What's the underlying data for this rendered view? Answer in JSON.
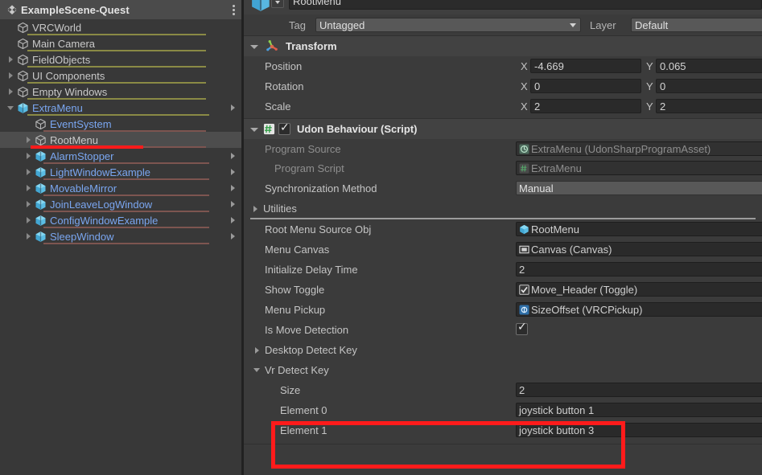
{
  "hierarchy": {
    "scene": {
      "name": "ExampleScene-Quest",
      "icon": "unity-scene-icon",
      "menu_icon": "kebab-menu-icon"
    },
    "items": [
      {
        "label": "VRCWorld",
        "icon": "gameobject-icon",
        "indent": 1,
        "twisty": "none",
        "prefab": false,
        "underline": "#8a8a45",
        "overflow_arrow": false,
        "selected": false
      },
      {
        "label": "Main Camera",
        "icon": "gameobject-icon",
        "indent": 1,
        "twisty": "none",
        "prefab": false,
        "underline": "#8a8a45",
        "overflow_arrow": false,
        "selected": false
      },
      {
        "label": "FieldObjects",
        "icon": "gameobject-icon",
        "indent": 1,
        "twisty": "right",
        "prefab": false,
        "underline": "#8a8a45",
        "overflow_arrow": false,
        "selected": false
      },
      {
        "label": "UI Components",
        "icon": "gameobject-icon",
        "indent": 1,
        "twisty": "right",
        "prefab": false,
        "underline": "#8a8a45",
        "overflow_arrow": false,
        "selected": false
      },
      {
        "label": "Empty Windows",
        "icon": "gameobject-icon",
        "indent": 1,
        "twisty": "right",
        "prefab": false,
        "underline": "#8a8a45",
        "overflow_arrow": false,
        "selected": false
      },
      {
        "label": "ExtraMenu",
        "icon": "prefab-icon",
        "indent": 1,
        "twisty": "down",
        "prefab": true,
        "underline": "#8a8a45",
        "overflow_arrow": true,
        "selected": false
      },
      {
        "label": "EventSystem",
        "icon": "gameobject-icon",
        "indent": 2,
        "twisty": "none",
        "prefab": true,
        "underline": "#7d5550",
        "overflow_arrow": false,
        "selected": false
      },
      {
        "label": "RootMenu",
        "icon": "gameobject-icon",
        "indent": 2,
        "twisty": "right",
        "prefab": false,
        "underline": "#7d5550",
        "overflow_arrow": false,
        "selected": true
      },
      {
        "label": "AlarmStopper",
        "icon": "prefab-icon",
        "indent": 2,
        "twisty": "right",
        "prefab": true,
        "underline": "#7d5550",
        "overflow_arrow": true,
        "selected": false
      },
      {
        "label": "LightWindowExample",
        "icon": "prefab-icon",
        "indent": 2,
        "twisty": "right",
        "prefab": true,
        "underline": "#7d5550",
        "overflow_arrow": true,
        "selected": false
      },
      {
        "label": "MovableMirror",
        "icon": "prefab-icon",
        "indent": 2,
        "twisty": "right",
        "prefab": true,
        "underline": "#7d5550",
        "overflow_arrow": true,
        "selected": false
      },
      {
        "label": "JoinLeaveLogWindow",
        "icon": "prefab-icon",
        "indent": 2,
        "twisty": "right",
        "prefab": true,
        "underline": "#7d5550",
        "overflow_arrow": true,
        "selected": false
      },
      {
        "label": "ConfigWindowExample",
        "icon": "prefab-icon",
        "indent": 2,
        "twisty": "right",
        "prefab": true,
        "underline": "#7d5550",
        "overflow_arrow": true,
        "selected": false
      },
      {
        "label": "SleepWindow",
        "icon": "prefab-icon",
        "indent": 2,
        "twisty": "right",
        "prefab": true,
        "underline": "#7d5550",
        "overflow_arrow": true,
        "selected": false
      }
    ]
  },
  "inspector": {
    "gameobject_name": "RootMenu",
    "enabled_checkbox": true,
    "tag_label": "Tag",
    "tag_value": "Untagged",
    "layer_label": "Layer",
    "layer_value": "Default",
    "transform": {
      "title": "Transform",
      "icon": "transform-axis-icon",
      "rows": [
        {
          "label": "Position",
          "x_axis": "X",
          "x": "-4.669",
          "y_axis": "Y",
          "y": "0.065"
        },
        {
          "label": "Rotation",
          "x_axis": "X",
          "x": "0",
          "y_axis": "Y",
          "y": "0"
        },
        {
          "label": "Scale",
          "x_axis": "X",
          "x": "2",
          "y_axis": "Y",
          "y": "2"
        }
      ]
    },
    "udon": {
      "title": "Udon Behaviour (Script)",
      "icon": "udon-script-icon",
      "enabled": true,
      "program_source_label": "Program Source",
      "program_source_value": "ExtraMenu (UdonSharpProgramAsset)",
      "program_source_icon": "udonsharp-asset-icon",
      "program_script_label": "Program Script",
      "program_script_value": "ExtraMenu",
      "program_script_icon": "script-icon",
      "sync_label": "Synchronization Method",
      "sync_value": "Manual",
      "utilities_label": "Utilities"
    },
    "fields": [
      {
        "label": "Root Menu Source Obj",
        "value": "RootMenu",
        "kind": "object",
        "icon": "prefab-icon"
      },
      {
        "label": "Menu Canvas",
        "value": "Canvas (Canvas)",
        "kind": "object",
        "icon": "canvas-icon"
      },
      {
        "label": "Initialize Delay Time",
        "value": "2",
        "kind": "number",
        "icon": ""
      },
      {
        "label": "Show Toggle",
        "value": "Move_Header (Toggle)",
        "kind": "object",
        "icon": "toggle-icon"
      },
      {
        "label": "Menu Pickup",
        "value": "SizeOffset (VRCPickup)",
        "kind": "object",
        "icon": "vrcpickup-icon"
      },
      {
        "label": "Is Move Detection",
        "value": "",
        "kind": "checkbox",
        "icon": "checkmark-icon"
      }
    ],
    "desktop_detect_key_label": "Desktop Detect Key",
    "vr_detect_key_label": "Vr Detect Key",
    "array": {
      "size_label": "Size",
      "size_value": "2",
      "elements": [
        {
          "label": "Element 0",
          "value": "joystick button 1"
        },
        {
          "label": "Element 1",
          "value": "joystick button 3"
        }
      ]
    }
  },
  "annotations": {
    "highlight_color": "#ff1b1b",
    "underline_target": "RootMenu",
    "box_target": "Vr Detect Key elements"
  }
}
